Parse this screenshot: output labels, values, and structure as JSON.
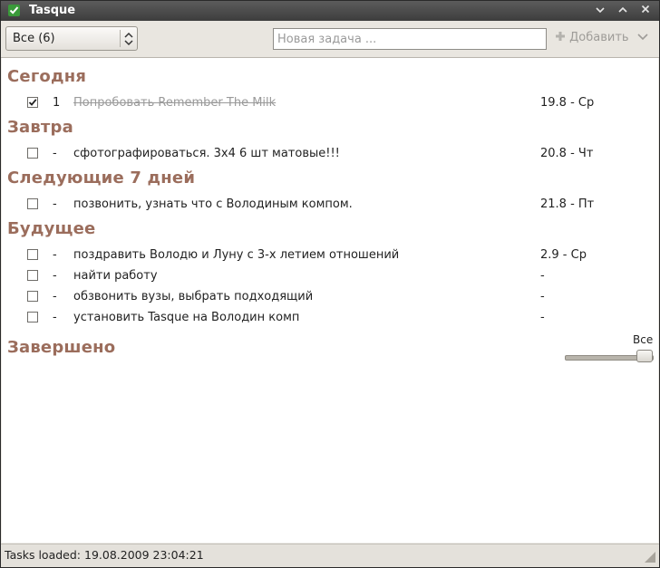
{
  "window": {
    "title": "Tasque",
    "icon": "check-icon"
  },
  "toolbar": {
    "category_selected": "Все (6)",
    "new_task_placeholder": "Новая задача ...",
    "add_label": "Добавить"
  },
  "sections": [
    {
      "title": "Сегодня"
    },
    {
      "title": "Завтра"
    },
    {
      "title": "Следующие 7 дней"
    },
    {
      "title": "Будущее"
    },
    {
      "title": "Завершено"
    }
  ],
  "tasks": [
    {
      "checked": true,
      "priority": "1",
      "name": "Попробовать Remember The Milk",
      "due": "19.8 - Ср"
    },
    {
      "checked": false,
      "priority": "-",
      "name": "сфотографироваться. 3х4 6 шт матовые!!!",
      "due": "20.8 - Чт"
    },
    {
      "checked": false,
      "priority": "-",
      "name": "позвонить, узнать что с Володиным компом.",
      "due": "21.8 - Пт"
    },
    {
      "checked": false,
      "priority": "-",
      "name": "поздравить Володю и Луну с 3-х летием отношений",
      "due": "2.9 - Ср"
    },
    {
      "checked": false,
      "priority": "-",
      "name": "найти работу",
      "due": "-"
    },
    {
      "checked": false,
      "priority": "-",
      "name": "обзвонить вузы, выбрать подходящий",
      "due": "-"
    },
    {
      "checked": false,
      "priority": "-",
      "name": "установить Tasque на Володин комп",
      "due": "-"
    }
  ],
  "completed": {
    "range_label": "Все",
    "range_level": 1.0
  },
  "status": {
    "text": "Tasks loaded: 19.08.2009 23:04:21"
  }
}
